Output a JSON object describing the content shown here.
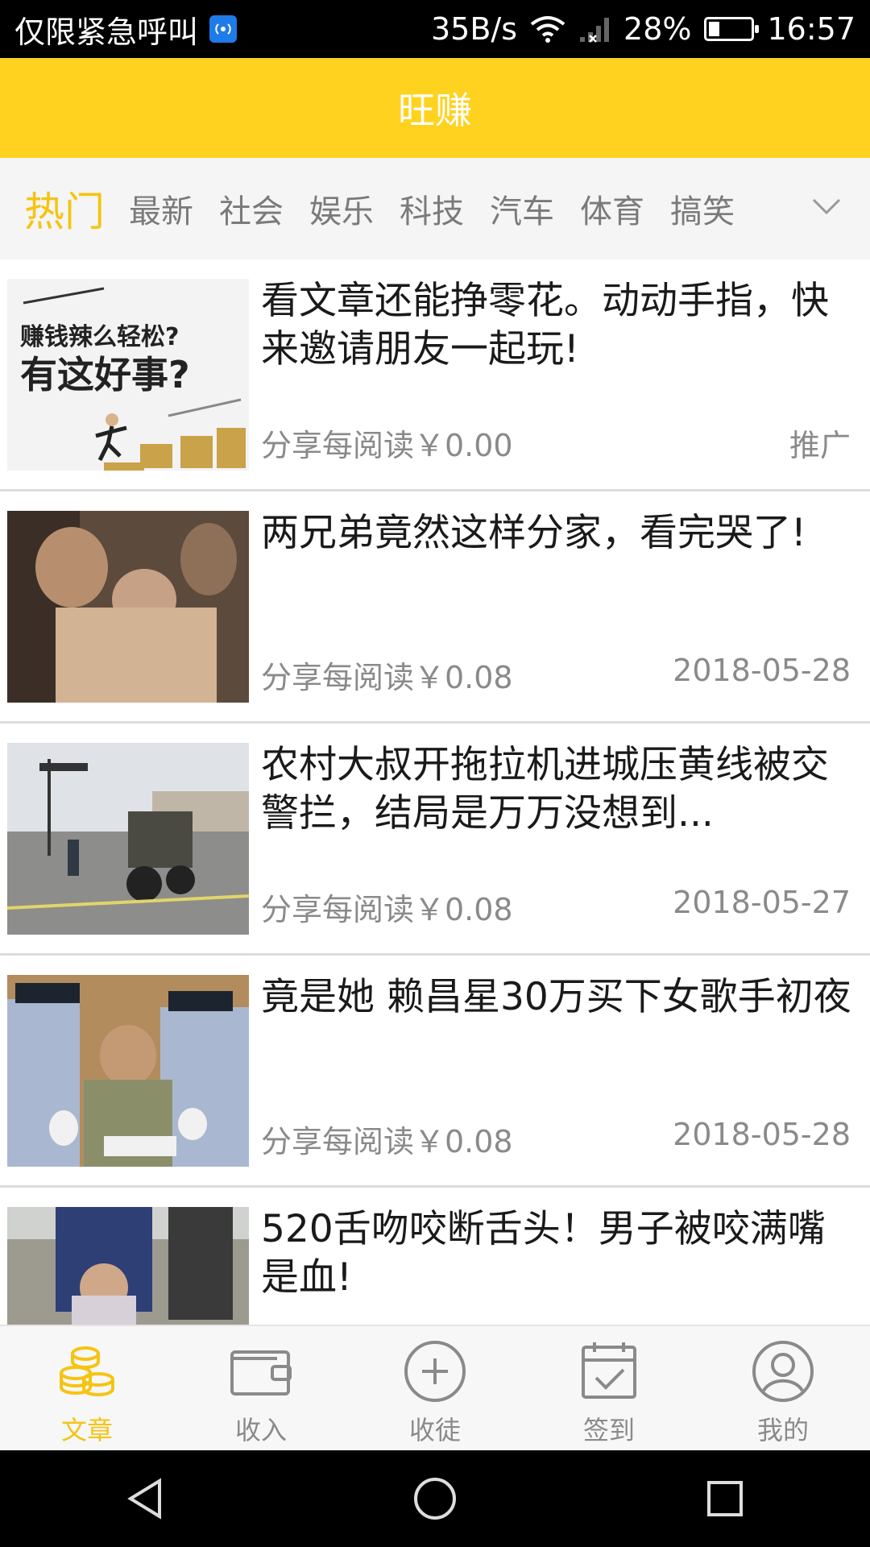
{
  "status_bar": {
    "carrier": "仅限紧急呼叫",
    "speed": "35B/s",
    "battery": "28%",
    "time": "16:57"
  },
  "header": {
    "title": "旺赚"
  },
  "tabs": [
    "热门",
    "最新",
    "社会",
    "娱乐",
    "科技",
    "汽车",
    "体育",
    "搞笑"
  ],
  "active_tab": "热门",
  "articles": [
    {
      "title": "看文章还能挣零花。动动手指，快来邀请朋友一起玩!",
      "reward": "分享每阅读￥0.00",
      "right": "推广",
      "thumb_text": [
        "赚钱辣么轻松?",
        "有这好事?"
      ]
    },
    {
      "title": "两兄弟竟然这样分家，看完哭了!",
      "reward": "分享每阅读￥0.08",
      "right": "2018-05-28"
    },
    {
      "title": "农村大叔开拖拉机进城压黄线被交警拦，结局是万万没想到...",
      "reward": "分享每阅读￥0.08",
      "right": "2018-05-27"
    },
    {
      "title": "竟是她 赖昌星30万买下女歌手初夜",
      "reward": "分享每阅读￥0.08",
      "right": "2018-05-28"
    },
    {
      "title": "520舌吻咬断舌头！男子被咬满嘴是血!",
      "reward": "",
      "right": ""
    }
  ],
  "bottom_nav": [
    {
      "label": "文章",
      "icon": "coins-icon"
    },
    {
      "label": "收入",
      "icon": "wallet-icon"
    },
    {
      "label": "收徒",
      "icon": "plus-circle-icon"
    },
    {
      "label": "签到",
      "icon": "calendar-check-icon"
    },
    {
      "label": "我的",
      "icon": "user-icon"
    }
  ],
  "colors": {
    "accent": "#ffd220",
    "active_text": "#f5c411"
  }
}
